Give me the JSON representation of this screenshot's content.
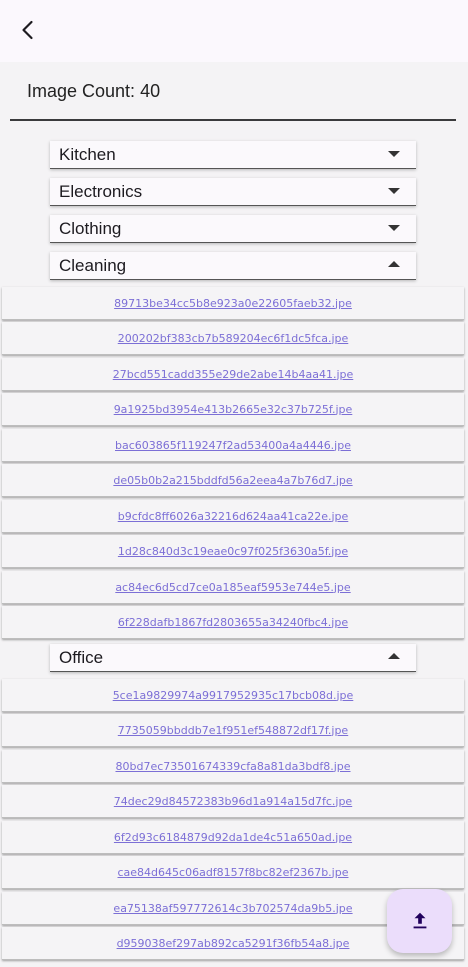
{
  "header": {
    "back_icon": "arrow-back-icon"
  },
  "image_count": {
    "text": "Image Count: 40"
  },
  "categories": [
    {
      "label": "Kitchen",
      "expanded": false
    },
    {
      "label": "Electronics",
      "expanded": false
    },
    {
      "label": "Clothing",
      "expanded": false
    },
    {
      "label": "Cleaning",
      "expanded": true
    },
    {
      "label": "Office",
      "expanded": true
    }
  ],
  "cleaning_files": [
    "89713be34cc5b8e923a0e22605faeb32.jpe",
    "200202bf383cb7b589204ec6f1dc5fca.jpe",
    "27bcd551cadd355e29de2abe14b4aa41.jpe",
    "9a1925bd3954e413b2665e32c37b725f.jpe",
    "bac603865f119247f2ad53400a4a4446.jpe",
    "de05b0b2a215bddfd56a2eea4a7b76d7.jpe",
    "b9cfdc8ff6026a32216d624aa41ca22e.jpe",
    "1d28c840d3c19eae0c97f025f3630a5f.jpe",
    "ac84ec6d5cd7ce0a185eaf5953e744e5.jpe",
    "6f228dafb1867fd2803655a34240fbc4.jpe"
  ],
  "office_files": [
    "5ce1a9829974a9917952935c17bcb08d.jpe",
    "7735059bbddb7e1f951ef548872df17f.jpe",
    "80bd7ec73501674339cfa8a81da3bdf8.jpe",
    "74dec29d84572383b96d1a914a15d7fc.jpe",
    "6f2d93c6184879d92da1de4c51a650ad.jpe",
    "cae84d645c06adf8157f8bc82ef2367b.jpe",
    "ea75138af597772614c3b702574da9b5.jpe",
    "d959038ef297ab892ca5291f36fb54a8.jpe"
  ],
  "fab": {
    "icon": "upload-icon"
  }
}
